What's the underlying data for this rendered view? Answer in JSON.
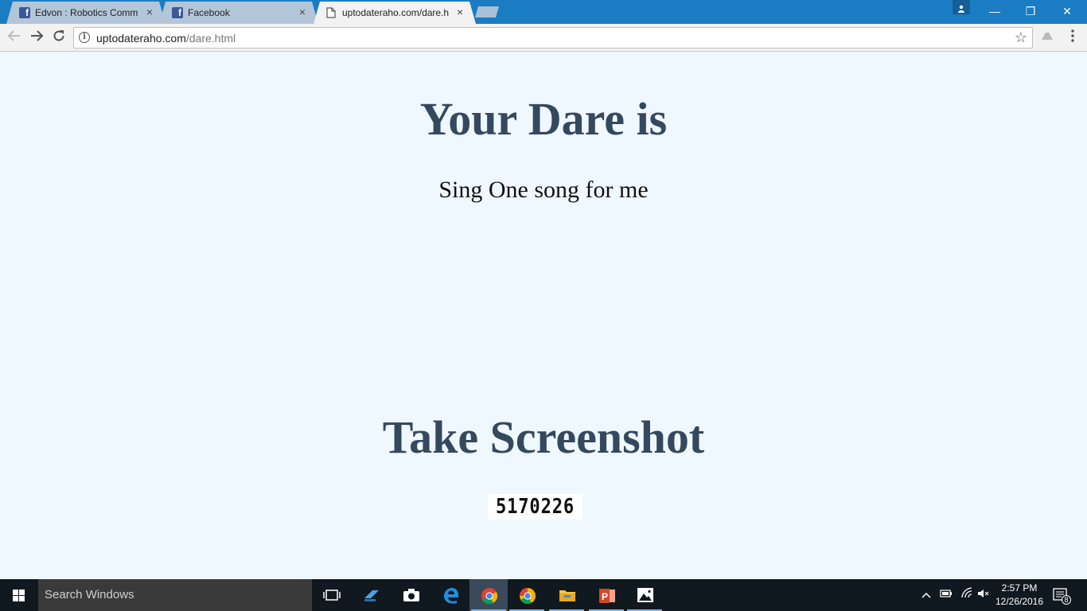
{
  "browser": {
    "tabs": [
      {
        "title": "Edvon : Robotics Commu",
        "favicon": "facebook-icon",
        "active": false
      },
      {
        "title": "Facebook",
        "favicon": "facebook-icon",
        "active": false
      },
      {
        "title": "uptodateraho.com/dare.h",
        "favicon": "page-icon",
        "active": true
      }
    ],
    "address": {
      "host": "uptodateraho.com",
      "path": "/dare.html"
    },
    "tab_close_glyph": "×",
    "window_controls": {
      "minimize": "—",
      "restore": "❐",
      "close": "✕"
    }
  },
  "page": {
    "heading": "Your Dare is",
    "dare_text": "Sing One song for me",
    "screenshot_heading": "Take Screenshot",
    "code": "5170226"
  },
  "taskbar": {
    "search_placeholder": "Search Windows",
    "clock_time": "2:57 PM",
    "clock_date": "12/26/2016",
    "notification_count": "8",
    "accent_color": "#7eb4ea"
  },
  "colors": {
    "titlebar": "#1a7dc4",
    "page_background": "#f0f8ff",
    "heading": "#34495e"
  }
}
